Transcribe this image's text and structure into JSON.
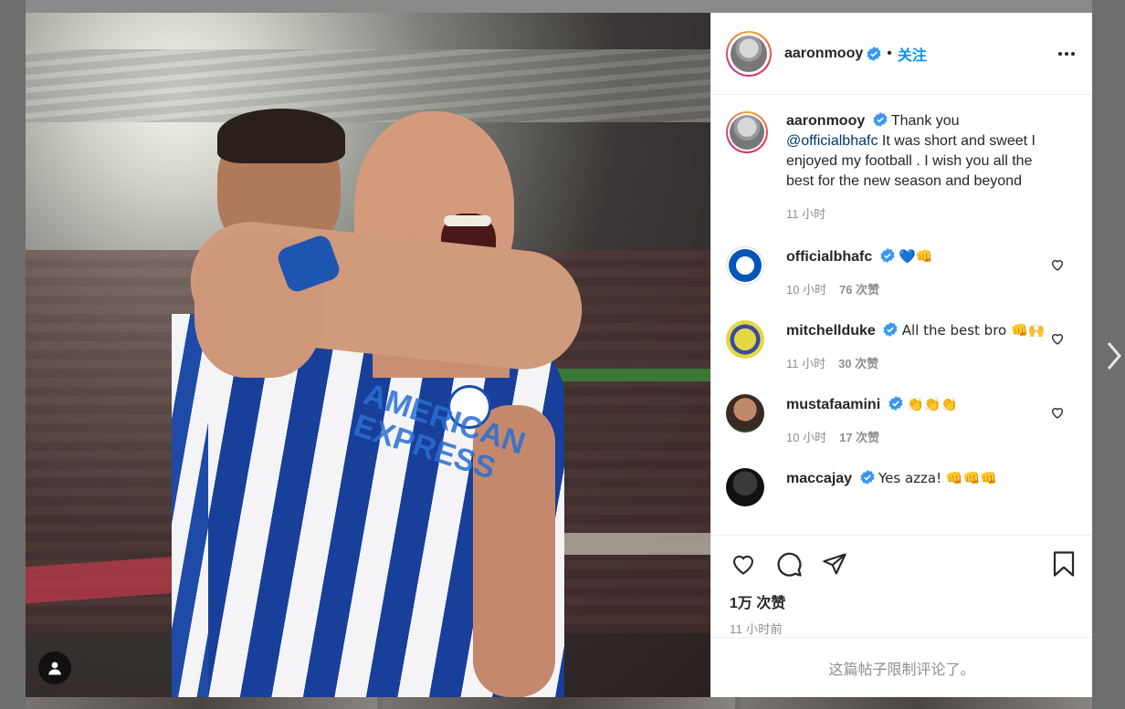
{
  "post": {
    "author": "aaronmooy",
    "follow_label": "关注",
    "separator": "•",
    "likes": "1万 次赞",
    "time_ago": "11 小时前",
    "comments_disabled": "这篇帖子限制评论了。"
  },
  "photo": {
    "sponsor_text": "AMERICAN EXPRESS"
  },
  "caption": {
    "user": "aaronmooy",
    "text_pre": "Thank you",
    "mention": "@officialbhafc",
    "text_post": "It was short and sweet I enjoyed my football . I wish you all the best for the new season and beyond",
    "time": "11 小时"
  },
  "comments": [
    {
      "user": "officialbhafc",
      "text": "💙👊",
      "time": "10 小时",
      "likes": "76 次赞"
    },
    {
      "user": "mitchellduke",
      "text": "All the best bro 👊🙌",
      "time": "11 小时",
      "likes": "30 次赞"
    },
    {
      "user": "mustafaamini",
      "text": "👏👏👏",
      "time": "10 小时",
      "likes": "17 次赞"
    },
    {
      "user": "maccajay",
      "text": "Yes azza! 👊👊👊"
    }
  ],
  "colors": {
    "accent": "#0095f6",
    "text": "#262626",
    "muted": "#8e8e8e",
    "verified": "#3897f0"
  }
}
